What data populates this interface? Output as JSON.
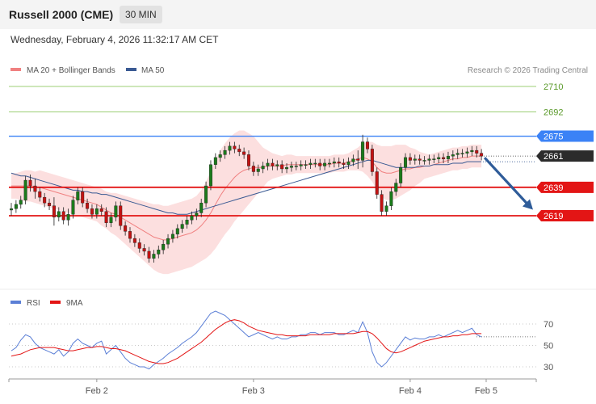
{
  "header": {
    "title": "Russell 2000 (CME)",
    "timeframe": "30 MIN",
    "datetime": "Wednesday, February 4, 2026 11:32:17 AM CET"
  },
  "colors": {
    "candle": "#1b7a1b",
    "candle_alt": "#c31212",
    "ma20": "#f08080",
    "bollinger_fill": "#fcd9d9",
    "ma50": "#3a5a93",
    "support": "#e31515",
    "resistance_blue": "#3b82f6",
    "pivot": "#2b2b2b",
    "green_level": "#7bbf47",
    "forecast_arrow": "#2f5c99",
    "rsi": "#5b7fd6",
    "rsi_ma": "#e31515"
  },
  "chart_data": [
    {
      "type": "candlestick",
      "title": "Russell 2000 (CME)",
      "legend": [
        {
          "label": "MA 20 + Bollinger Bands",
          "color": "#f08080"
        },
        {
          "label": "MA 50",
          "color": "#3a5a93"
        }
      ],
      "watermark": "Research © 2026 Trading Central",
      "ylim": [
        2602,
        2716
      ],
      "levels": [
        {
          "value": 2710,
          "label": "2710",
          "style": "green"
        },
        {
          "value": 2692,
          "label": "2692",
          "style": "green"
        },
        {
          "value": 2675,
          "label": "2675",
          "style": "blue"
        },
        {
          "value": 2661,
          "label": "2661",
          "style": "pivot"
        },
        {
          "value": 2639,
          "label": "2639",
          "style": "red"
        },
        {
          "value": 2619,
          "label": "2619",
          "style": "red"
        }
      ],
      "x_ticks": [
        {
          "index": 18,
          "label": "Feb 2"
        },
        {
          "index": 51,
          "label": "Feb 3"
        },
        {
          "index": 84,
          "label": "Feb 4"
        },
        {
          "index": 100,
          "label": "Feb 5"
        }
      ],
      "forecast": {
        "from_index": 99,
        "from_value": 2661,
        "to_index": 109,
        "to_value": 2621
      },
      "close": [
        2624,
        2627,
        2630,
        2644,
        2640,
        2636,
        2632,
        2628,
        2626,
        2618,
        2622,
        2616,
        2620,
        2630,
        2636,
        2628,
        2624,
        2620,
        2624,
        2622,
        2614,
        2618,
        2626,
        2612,
        2608,
        2603,
        2600,
        2596,
        2594,
        2589,
        2592,
        2595,
        2599,
        2603,
        2606,
        2610,
        2613,
        2616,
        2619,
        2621,
        2628,
        2640,
        2655,
        2660,
        2662,
        2665,
        2668,
        2666,
        2664,
        2662,
        2654,
        2650,
        2652,
        2654,
        2656,
        2654,
        2655,
        2652,
        2653,
        2654,
        2654,
        2655,
        2655,
        2656,
        2656,
        2654,
        2656,
        2656,
        2657,
        2656,
        2655,
        2657,
        2659,
        2658,
        2671,
        2666,
        2650,
        2634,
        2622,
        2626,
        2636,
        2642,
        2653,
        2660,
        2658,
        2659,
        2658,
        2658,
        2659,
        2659,
        2660,
        2659,
        2661,
        2662,
        2663,
        2663,
        2664,
        2665,
        2663,
        2661
      ],
      "high_adj": [
        4,
        3,
        3,
        3,
        4,
        5,
        3,
        3,
        3,
        6,
        3,
        3,
        4,
        3,
        3,
        3,
        3,
        3,
        3,
        3,
        3,
        3,
        3,
        3,
        3,
        3,
        3,
        3,
        3,
        3,
        3,
        3,
        3,
        3,
        3,
        3,
        3,
        3,
        3,
        3,
        3,
        3,
        3,
        3,
        3,
        3,
        3,
        3,
        3,
        3,
        3,
        3,
        3,
        3,
        3,
        3,
        3,
        3,
        3,
        3,
        3,
        3,
        3,
        3,
        3,
        3,
        3,
        3,
        3,
        3,
        3,
        3,
        3,
        6,
        5,
        3,
        3,
        3,
        3,
        3,
        3,
        3,
        3,
        3,
        3,
        3,
        3,
        3,
        3,
        3,
        3,
        3,
        3,
        3,
        3,
        3,
        3,
        3,
        3,
        3
      ],
      "bb_mid": [
        2640,
        2640,
        2640,
        2640,
        2640,
        2639,
        2639,
        2638,
        2637,
        2636,
        2635,
        2634,
        2633,
        2632,
        2631,
        2630,
        2629,
        2628,
        2627,
        2625,
        2623,
        2621,
        2620,
        2618,
        2616,
        2614,
        2612,
        2610,
        2608,
        2606,
        2604,
        2603,
        2602,
        2602,
        2603,
        2604,
        2605,
        2606,
        2607,
        2609,
        2612,
        2616,
        2621,
        2627,
        2633,
        2638,
        2642,
        2646,
        2649,
        2651,
        2652,
        2653,
        2653,
        2653,
        2654,
        2654,
        2654,
        2654,
        2655,
        2655,
        2655,
        2655,
        2655,
        2655,
        2655,
        2655,
        2655,
        2655,
        2656,
        2656,
        2656,
        2657,
        2658,
        2659,
        2660,
        2659,
        2657,
        2653,
        2650,
        2649,
        2649,
        2650,
        2651,
        2652,
        2652,
        2653,
        2653,
        2654,
        2654,
        2655,
        2656,
        2657,
        2658,
        2659,
        2659,
        2660,
        2660,
        2661,
        2661,
        2661
      ],
      "bb_width": [
        9,
        9,
        10,
        11,
        11,
        11,
        12,
        12,
        12,
        12,
        12,
        12,
        12,
        12,
        12,
        12,
        12,
        12,
        12,
        13,
        13,
        14,
        15,
        16,
        17,
        18,
        19,
        20,
        21,
        22,
        23,
        24,
        24,
        24,
        24,
        24,
        24,
        24,
        24,
        24,
        25,
        27,
        29,
        31,
        32,
        32,
        32,
        31,
        30,
        28,
        25,
        22,
        18,
        14,
        11,
        9,
        8,
        7,
        7,
        7,
        6,
        6,
        6,
        6,
        6,
        6,
        6,
        6,
        6,
        6,
        6,
        6,
        7,
        8,
        10,
        12,
        14,
        16,
        18,
        19,
        19,
        19,
        18,
        17,
        15,
        13,
        11,
        9,
        8,
        8,
        8,
        8,
        8,
        8,
        8,
        8,
        8,
        8,
        8,
        8
      ],
      "ma50": [
        2649,
        2648,
        2647,
        2647,
        2646,
        2645,
        2644,
        2643,
        2642,
        2641,
        2640,
        2639,
        2638,
        2637,
        2637,
        2636,
        2636,
        2635,
        2635,
        2634,
        2634,
        2633,
        2632,
        2631,
        2630,
        2629,
        2628,
        2627,
        2626,
        2625,
        2624,
        2623,
        2622,
        2621,
        2621,
        2620,
        2620,
        2620,
        2621,
        2622,
        2623,
        2624,
        2625,
        2626,
        2627,
        2628,
        2629,
        2630,
        2631,
        2632,
        2633,
        2634,
        2635,
        2636,
        2637,
        2638,
        2639,
        2640,
        2641,
        2642,
        2643,
        2644,
        2645,
        2646,
        2647,
        2648,
        2649,
        2650,
        2651,
        2652,
        2653,
        2654,
        2655,
        2656,
        2657,
        2658,
        2658,
        2657,
        2656,
        2655,
        2654,
        2653,
        2653,
        2653,
        2653,
        2653,
        2654,
        2654,
        2654,
        2655,
        2655,
        2655,
        2655,
        2656,
        2656,
        2656,
        2657,
        2657,
        2657,
        2657
      ]
    },
    {
      "type": "line",
      "title": "",
      "legend": [
        {
          "label": "RSI",
          "color": "#5b7fd6"
        },
        {
          "label": "9MA",
          "color": "#e31515"
        }
      ],
      "ylim": [
        22,
        82
      ],
      "y_ticks": [
        70,
        50,
        30
      ],
      "rsi": [
        45,
        48,
        55,
        60,
        58,
        52,
        48,
        46,
        44,
        42,
        46,
        40,
        44,
        52,
        56,
        52,
        50,
        48,
        52,
        54,
        42,
        46,
        50,
        44,
        38,
        34,
        32,
        30,
        30,
        28,
        32,
        35,
        38,
        42,
        45,
        48,
        52,
        55,
        58,
        62,
        68,
        74,
        80,
        82,
        80,
        78,
        74,
        70,
        66,
        62,
        58,
        60,
        62,
        60,
        58,
        56,
        58,
        56,
        56,
        58,
        58,
        60,
        60,
        62,
        62,
        60,
        62,
        62,
        62,
        60,
        60,
        62,
        64,
        62,
        72,
        62,
        44,
        34,
        30,
        34,
        40,
        46,
        52,
        58,
        55,
        57,
        56,
        56,
        58,
        58,
        60,
        58,
        60,
        62,
        64,
        62,
        64,
        66,
        60,
        58
      ],
      "rsi_ma": [
        40,
        41,
        42,
        44,
        46,
        47,
        48,
        48,
        48,
        48,
        47,
        46,
        45,
        45,
        46,
        47,
        48,
        48,
        49,
        49,
        48,
        47,
        47,
        46,
        45,
        43,
        41,
        39,
        37,
        35,
        34,
        33,
        33,
        34,
        36,
        38,
        41,
        44,
        47,
        50,
        53,
        57,
        61,
        65,
        68,
        71,
        73,
        74,
        73,
        71,
        68,
        66,
        64,
        63,
        62,
        61,
        60,
        60,
        59,
        59,
        59,
        59,
        59,
        60,
        60,
        60,
        60,
        60,
        61,
        61,
        61,
        61,
        61,
        62,
        63,
        63,
        61,
        57,
        52,
        47,
        44,
        43,
        44,
        46,
        48,
        50,
        52,
        54,
        55,
        56,
        57,
        58,
        58,
        59,
        59,
        60,
        60,
        61,
        61,
        61
      ],
      "dotted_level": 58
    }
  ]
}
